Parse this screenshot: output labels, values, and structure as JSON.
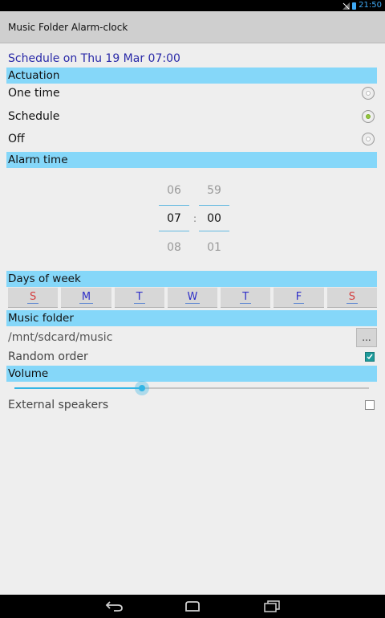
{
  "status_bar": {
    "time": "21:50"
  },
  "app": {
    "title": "Music Folder Alarm-clock"
  },
  "schedule": {
    "summary": "Schedule on Thu 19 Mar 07:00"
  },
  "sections": {
    "actuation": "Actuation",
    "alarm_time": "Alarm time",
    "days_of_week": "Days of week",
    "music_folder": "Music folder",
    "volume": "Volume"
  },
  "actuation_options": [
    {
      "label": "One time",
      "selected": false
    },
    {
      "label": "Schedule",
      "selected": true
    },
    {
      "label": "Off",
      "selected": false
    }
  ],
  "alarm_time": {
    "hour_prev": "06",
    "hour": "07",
    "hour_next": "08",
    "minute_prev": "59",
    "minute": "00",
    "minute_next": "01",
    "separator": ":"
  },
  "days": [
    "S",
    "M",
    "T",
    "W",
    "T",
    "F",
    "S"
  ],
  "music_folder": {
    "path": "/mnt/sdcard/music",
    "browse_label": "..."
  },
  "random_order": {
    "label": "Random order",
    "checked": true
  },
  "volume": {
    "level": 0.36
  },
  "external_speakers": {
    "label": "External speakers",
    "checked": false
  },
  "colors": {
    "section_bg": "#85d7f9",
    "summary_text": "#2a2aa8",
    "accent": "#33b5e5",
    "radio_checked": "#93c63f",
    "checkbox_checked": "#1e9a9a",
    "weekend_day": "#d43c3c",
    "weekday": "#2f2fc8"
  },
  "icons": {
    "status": [
      "signal-icon",
      "battery-icon"
    ],
    "nav": [
      "back-icon",
      "home-icon",
      "recent-apps-icon"
    ]
  }
}
